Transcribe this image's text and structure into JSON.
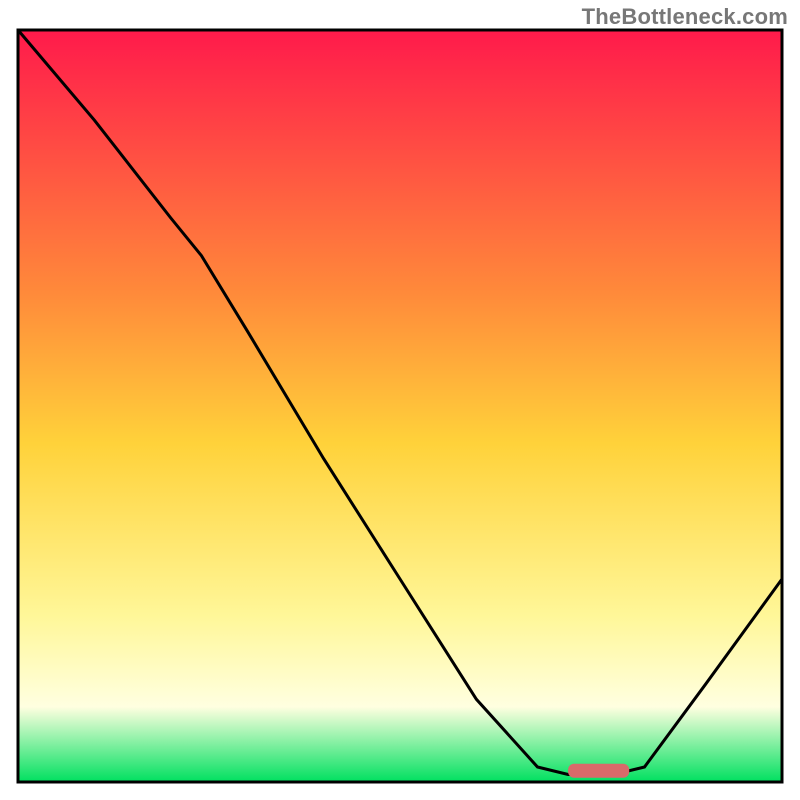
{
  "watermark": "TheBottleneck.com",
  "chart_data": {
    "type": "line",
    "title": "",
    "xlabel": "",
    "ylabel": "",
    "xlim": [
      0,
      100
    ],
    "ylim": [
      0,
      100
    ],
    "colors": {
      "gradient_top": "#ff1a4b",
      "gradient_mid_upper": "#ff8a3a",
      "gradient_mid": "#ffd23a",
      "gradient_mid_lower": "#fff799",
      "gradient_lower": "#ffffe0",
      "gradient_bottom": "#00e060",
      "line": "#000000",
      "marker": "#d96a6a",
      "border": "#000000"
    },
    "curve": [
      {
        "x": 0,
        "y": 100
      },
      {
        "x": 10,
        "y": 88
      },
      {
        "x": 20,
        "y": 75
      },
      {
        "x": 24,
        "y": 70
      },
      {
        "x": 30,
        "y": 60
      },
      {
        "x": 40,
        "y": 43
      },
      {
        "x": 50,
        "y": 27
      },
      {
        "x": 60,
        "y": 11
      },
      {
        "x": 68,
        "y": 2
      },
      {
        "x": 72,
        "y": 1
      },
      {
        "x": 78,
        "y": 1
      },
      {
        "x": 82,
        "y": 2
      },
      {
        "x": 90,
        "y": 13
      },
      {
        "x": 100,
        "y": 27
      }
    ],
    "marker_segment": {
      "x_start": 72,
      "x_end": 80,
      "y": 1.5
    }
  }
}
